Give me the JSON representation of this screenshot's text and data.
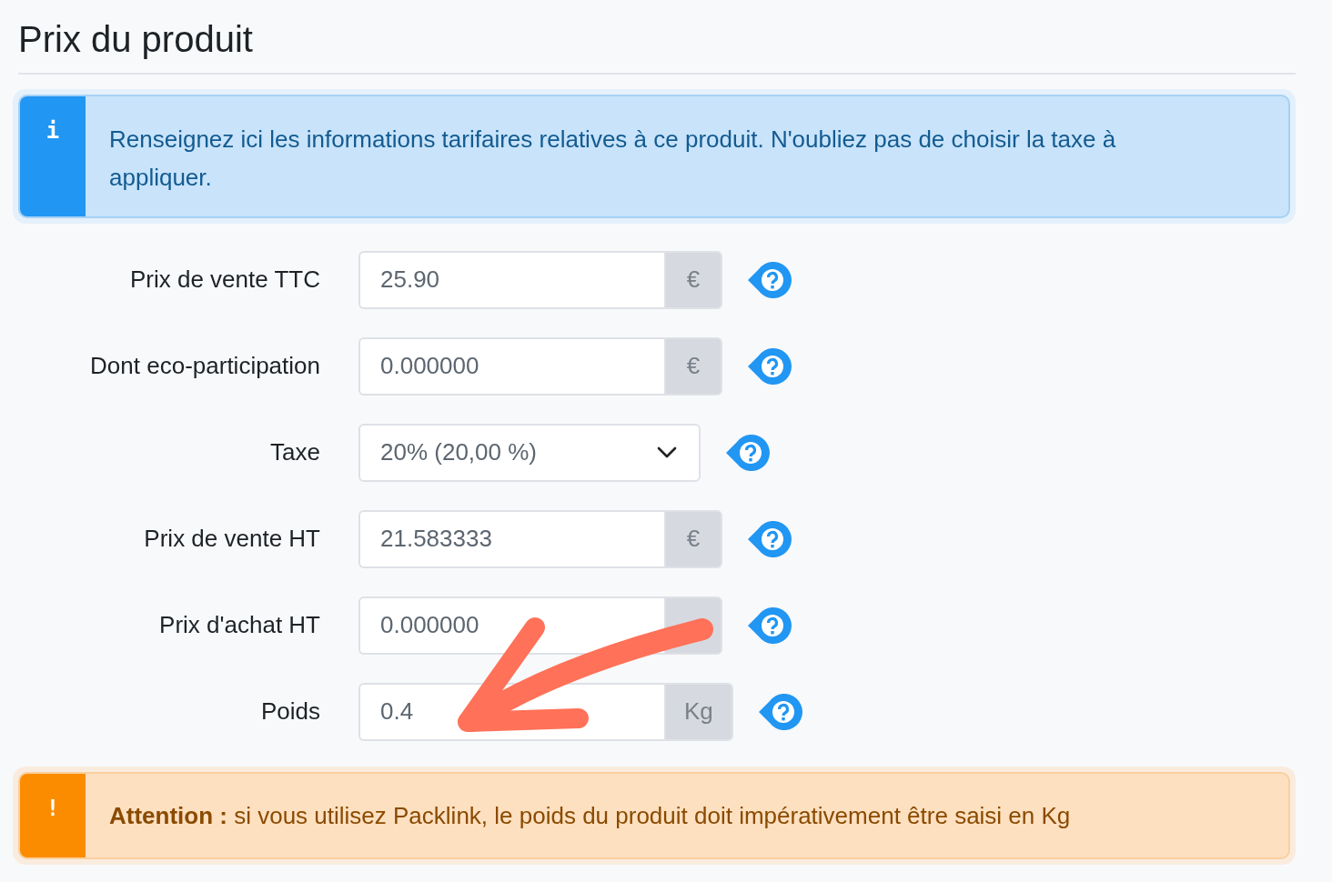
{
  "title": "Prix du produit",
  "info": {
    "icon": "i",
    "text": "Renseignez ici les informations tarifaires relatives à ce produit. N'oubliez pas de choisir la taxe à appliquer."
  },
  "fields": [
    {
      "label": "Prix de vente TTC",
      "kind": "input",
      "value": "25.90",
      "unit": "€"
    },
    {
      "label": "Dont eco-participation",
      "kind": "input",
      "value": "0.000000",
      "unit": "€"
    },
    {
      "label": "Taxe",
      "kind": "select",
      "value": "20% (20,00 %)"
    },
    {
      "label": "Prix de vente HT",
      "kind": "input",
      "value": "21.583333",
      "unit": "€"
    },
    {
      "label": "Prix d'achat HT",
      "kind": "input",
      "value": "0.000000"
    },
    {
      "label": "Poids",
      "kind": "input",
      "value": "0.4",
      "unit": "Kg"
    }
  ],
  "warning": {
    "icon": "!",
    "text": "**Attention :** si vous utilisez Packlink, le poids du produit doit impérativement être saisi en Kg"
  }
}
